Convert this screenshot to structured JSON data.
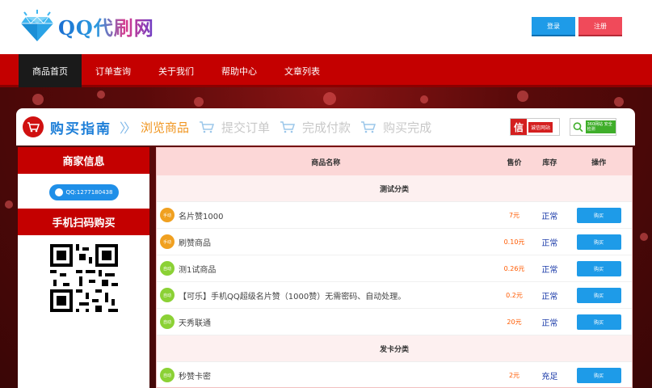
{
  "header": {
    "logo_text": "QQ代刷网",
    "login_label": "登录",
    "register_label": "注册"
  },
  "nav": {
    "items": [
      "商品首页",
      "订单查询",
      "关于我们",
      "帮助中心",
      "文章列表"
    ],
    "active_index": 0
  },
  "guide": {
    "title": "购买指南",
    "steps": [
      "浏览商品",
      "提交订单",
      "完成付款",
      "购买完成"
    ],
    "active_step": 0,
    "cert1_mark": "信",
    "cert1_text": "诚信网站",
    "cert2_text": "360网站 安全检测"
  },
  "sidebar": {
    "merchant_title": "商家信息",
    "qq_label": "QQ:1277180438",
    "scan_title": "手机扫码购买"
  },
  "table": {
    "headers": {
      "name": "商品名称",
      "price": "售价",
      "stock": "库存",
      "op": "操作"
    },
    "categories": [
      {
        "name": "测试分类",
        "products": [
          {
            "badge": "手动",
            "badge_type": "manual",
            "name": "名片赞1000",
            "price": "7元",
            "stock": "正常",
            "action": "购买"
          },
          {
            "badge": "手动",
            "badge_type": "manual",
            "name": "刷赞商品",
            "price": "0.10元",
            "stock": "正常",
            "action": "购买"
          },
          {
            "badge": "自动",
            "badge_type": "auto",
            "name": "测1试商品",
            "price": "0.26元",
            "stock": "正常",
            "action": "购买"
          },
          {
            "badge": "自动",
            "badge_type": "auto",
            "name": "【可乐】手机QQ超级名片赞（1000赞）无需密码、自动处理。",
            "price": "0.2元",
            "stock": "正常",
            "action": "购买"
          },
          {
            "badge": "自动",
            "badge_type": "auto",
            "name": "天秀联通",
            "price": "20元",
            "stock": "正常",
            "action": "购买"
          }
        ]
      },
      {
        "name": "发卡分类",
        "products": [
          {
            "badge": "自动",
            "badge_type": "auto",
            "name": "秒赞卡密",
            "price": "2元",
            "stock": "充足",
            "action": "购买"
          }
        ]
      }
    ]
  },
  "colors": {
    "brand_red": "#c40000",
    "accent_blue": "#1e9be8",
    "price_orange": "#ff5a00",
    "stock_blue": "#1a3aa8",
    "step_active": "#f0951f"
  }
}
